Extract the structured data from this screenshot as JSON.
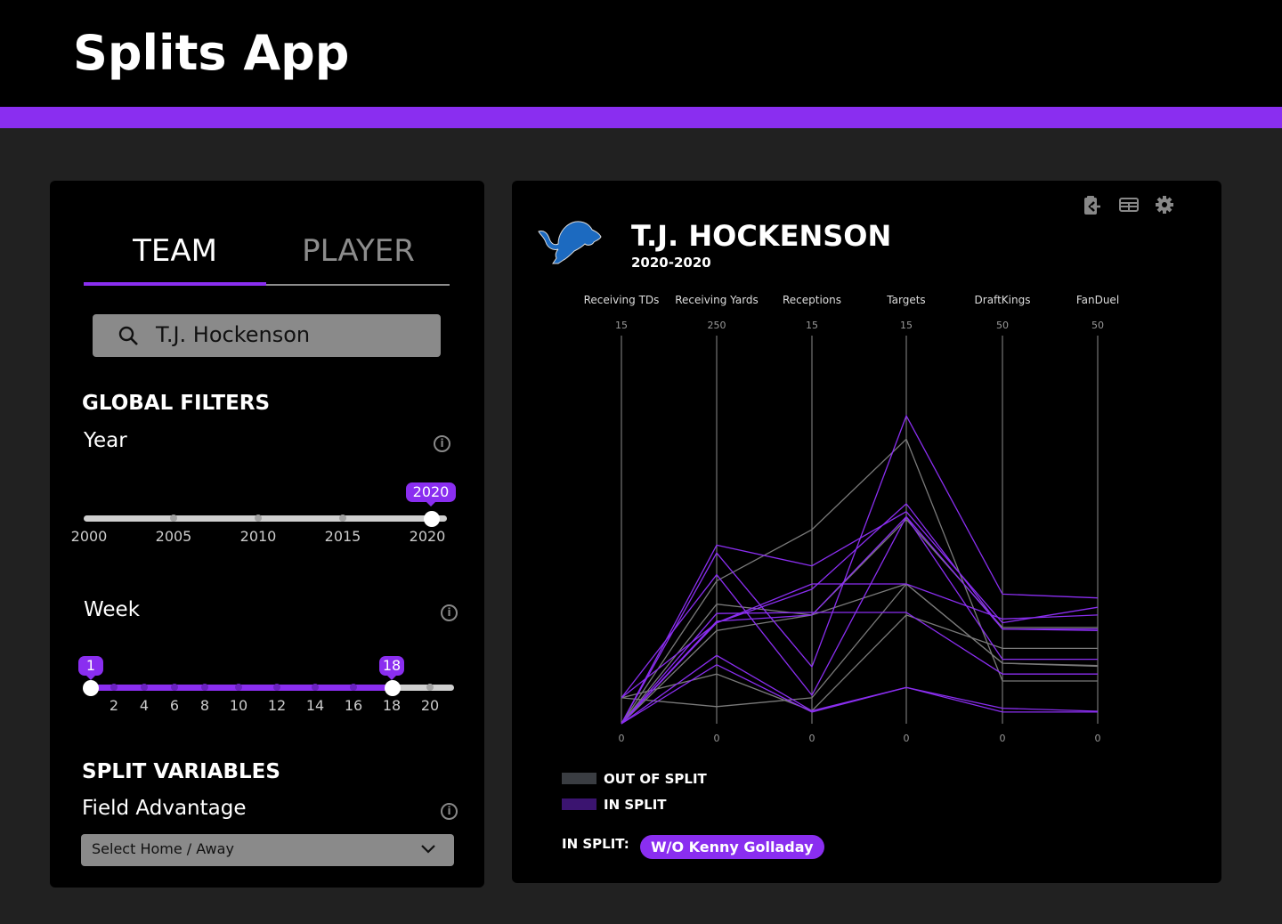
{
  "app": {
    "title": "Splits App",
    "accent": "#8a2ef0"
  },
  "tabs": [
    {
      "label": "TEAM",
      "active": true
    },
    {
      "label": "PLAYER",
      "active": false
    }
  ],
  "search": {
    "value": "T.J. Hockenson",
    "icon": "search-icon"
  },
  "global_filters": {
    "title": "GLOBAL FILTERS",
    "year": {
      "label": "Year",
      "min": 2000,
      "max": 2020,
      "value": 2020,
      "ticks": [
        "2000",
        "2005",
        "2010",
        "2015",
        "2020"
      ],
      "value_label": "2020"
    },
    "week": {
      "label": "Week",
      "min": 1,
      "max": 20,
      "range": [
        1,
        18
      ],
      "low_label": "1",
      "high_label": "18",
      "ticks": [
        "2",
        "4",
        "6",
        "8",
        "10",
        "12",
        "14",
        "16",
        "18",
        "20"
      ]
    }
  },
  "split_variables": {
    "title": "SPLIT VARIABLES",
    "field_advantage": {
      "label": "Field Advantage",
      "placeholder": "Select Home / Away"
    }
  },
  "player": {
    "name": "T.J. HOCKENSON",
    "years": "2020-2020",
    "team_logo": "detroit-lions-logo"
  },
  "toolbar": {
    "icons": [
      "clipboard-export-icon",
      "table-icon",
      "gear-icon"
    ]
  },
  "legend": {
    "out": "OUT OF SPLIT",
    "in": "IN SPLIT",
    "out_color": "#3a3d42",
    "in_color": "#3b1470"
  },
  "in_split": {
    "label": "IN SPLIT:",
    "value": "W/O Kenny Golladay"
  },
  "chart_data": {
    "type": "parallel-coordinates",
    "axes": [
      {
        "label": "Receiving TDs",
        "min": 0,
        "max": 15,
        "min_label": "0",
        "max_label": "15"
      },
      {
        "label": "Receiving Yards",
        "min": 0,
        "max": 250,
        "min_label": "0",
        "max_label": "250"
      },
      {
        "label": "Receptions",
        "min": 0,
        "max": 15,
        "min_label": "0",
        "max_label": "15"
      },
      {
        "label": "Targets",
        "min": 0,
        "max": 15,
        "min_label": "0",
        "max_label": "15"
      },
      {
        "label": "DraftKings",
        "min": 0,
        "max": 50,
        "min_label": "0",
        "max_label": "50"
      },
      {
        "label": "FanDuel",
        "min": 0,
        "max": 50,
        "min_label": "0",
        "max_label": "50"
      }
    ],
    "series": [
      {
        "group": "out",
        "values": [
          0,
          92,
          7.5,
          11,
          5.5,
          5.5
        ]
      },
      {
        "group": "out",
        "values": [
          1,
          11,
          1,
          5.4,
          7.8,
          7.5
        ]
      },
      {
        "group": "out",
        "values": [
          1,
          32,
          0.5,
          4.2,
          9.7,
          9.7
        ]
      },
      {
        "group": "out",
        "values": [
          0,
          77,
          4.2,
          5.4,
          7.8,
          7.4
        ]
      },
      {
        "group": "out",
        "values": [
          0,
          60,
          4.2,
          7.9,
          12.4,
          12.4
        ]
      },
      {
        "group": "in",
        "values": [
          0,
          115,
          6.1,
          8.2,
          13,
          15
        ]
      },
      {
        "group": "in",
        "values": [
          0,
          110,
          2.2,
          11.9,
          16.7,
          16.2
        ]
      },
      {
        "group": "in",
        "values": [
          1,
          96,
          1.1,
          8,
          12.2,
          12.2
        ]
      },
      {
        "group": "in",
        "values": [
          1,
          65,
          5.4,
          5.4,
          13.5,
          14
        ]
      },
      {
        "group": "in",
        "values": [
          0,
          71,
          4.3,
          4.3,
          6.4,
          6.4
        ]
      },
      {
        "group": "in",
        "values": [
          0,
          65,
          5.2,
          8.5,
          12.2,
          12
        ]
      },
      {
        "group": "in",
        "values": [
          0,
          44,
          0.5,
          1.4,
          2,
          1.6
        ]
      },
      {
        "group": "in",
        "values": [
          0,
          38,
          0.45,
          1.4,
          1.5,
          1.5
        ]
      },
      {
        "group": "in",
        "values": [
          0,
          66,
          4.2,
          8,
          8.3,
          8.3
        ]
      }
    ],
    "colors": {
      "out": "#7a7a7a",
      "in": "#8a2ef0",
      "axis": "#8c8c8c"
    }
  }
}
